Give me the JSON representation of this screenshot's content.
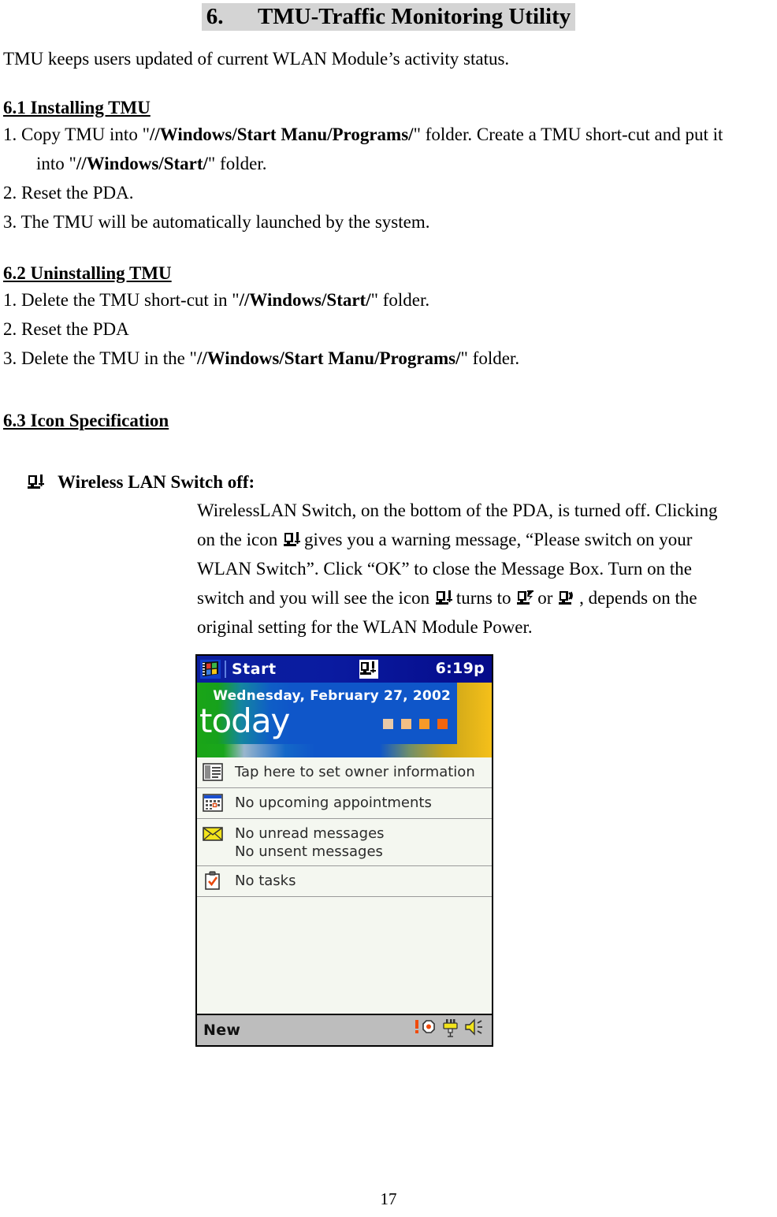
{
  "document": {
    "title_number": "6.",
    "title_text": "TMU-Traffic Monitoring Utility",
    "intro": "TMU keeps users updated of current WLAN Module’s activity status.",
    "page_number": "17"
  },
  "section_61": {
    "heading": "6.1 Installing TMU",
    "step1_a": "1. Copy TMU into \"",
    "step1_path": "//Windows/Start Manu/Programs/",
    "step1_b": "\" folder.    Create a TMU short-cut and put it",
    "step1_cont_a": "into \"",
    "step1_cont_path": "//Windows/Start/",
    "step1_cont_b": "\" folder.",
    "step2": "2. Reset the PDA.",
    "step3": "3. The TMU will be automatically launched by the system."
  },
  "section_62": {
    "heading": "6.2 Uninstalling TMU",
    "step1_a": "1. Delete the TMU short-cut in \"",
    "step1_path": "//Windows/Start/",
    "step1_b": "\" folder.",
    "step2": "2. Reset the PDA",
    "step3_a": "3. Delete the TMU in the \"",
    "step3_path": "//Windows/Start Manu/Programs/",
    "step3_b": "\" folder."
  },
  "section_63": {
    "heading": "6.3 Icon Specification",
    "icon_title": "Wireless LAN Switch off:",
    "para_1a": "WirelessLAN Switch, on the bottom of the PDA, is turned off.    Clicking",
    "para_1b": "on the icon",
    "para_1c": "gives you a warning message, “Please switch on your",
    "para_2": "WLAN Switch”.    Click “OK” to close the Message Box.    Turn on the",
    "para_3a": "switch and you will see the icon",
    "para_3b": "turns to",
    "para_3c": "or",
    "para_3d": ", depends on the",
    "para_4": "original setting for the WLAN Module Power.",
    "icon_names": {
      "off": "wlan-switch-off-icon",
      "active": "wlan-active-icon",
      "power": "wlan-power-icon"
    }
  },
  "pda_screenshot": {
    "start_label": "Start",
    "clock": "6:19p",
    "date": "Wednesday, February 27, 2002",
    "today_word": "today",
    "today_squares_colors": [
      "#e8c9a8",
      "#f4bf84",
      "#f59a28",
      "#f2650d"
    ],
    "rows": [
      {
        "icon": "owner-info-icon",
        "lines": [
          "Tap here to set owner information"
        ]
      },
      {
        "icon": "calendar-icon",
        "lines": [
          "No upcoming appointments"
        ]
      },
      {
        "icon": "envelope-icon",
        "lines": [
          "No unread messages",
          "No unsent messages"
        ]
      },
      {
        "icon": "clipboard-icon",
        "lines": [
          "No tasks"
        ]
      }
    ],
    "new_button": "New",
    "tray": [
      "alert-icon",
      "plug-icon",
      "speaker-icon"
    ],
    "colors": {
      "titlebar": "#050b8a",
      "banner_blue": "#0f56c9",
      "banner_green": "#1aa517",
      "banner_yellow": "#f5c01a",
      "body": "#f4f7f0",
      "bottombar": "#bdbdbd"
    }
  }
}
